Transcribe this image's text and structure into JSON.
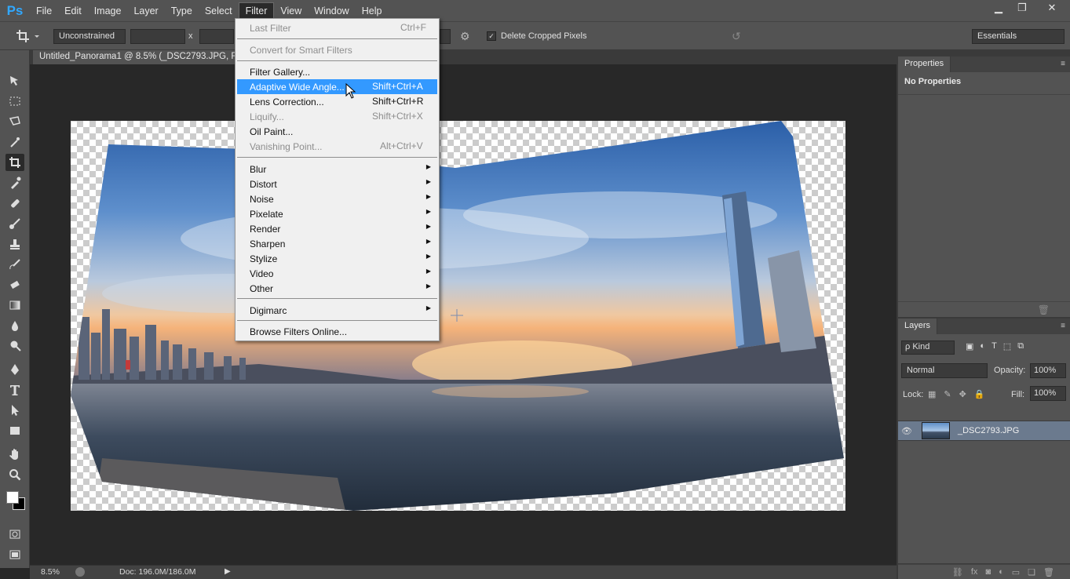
{
  "app": {
    "logo": "Ps"
  },
  "menubar": {
    "items": [
      "File",
      "Edit",
      "Image",
      "Layer",
      "Type",
      "Select",
      "Filter",
      "View",
      "Window",
      "Help"
    ],
    "active": "Filter"
  },
  "window_controls": {
    "minimize": "▁",
    "restore": "❐",
    "close": "✕"
  },
  "options": {
    "ratio_select": "Unconstrained",
    "separator_x": "x",
    "delete_cropped_label": "Delete Cropped Pixels",
    "delete_cropped_checked": "✓",
    "workspace": "Essentials"
  },
  "document": {
    "tab_title": "Untitled_Panorama1 @ 8.5% (_DSC2793.JPG, RGB/8)"
  },
  "status": {
    "zoom": "8.5%",
    "doc_info": "Doc: 196.0M/186.0M",
    "arrow": "▶"
  },
  "properties_panel": {
    "tab": "Properties",
    "message": "No Properties",
    "menu_icon": "≡"
  },
  "layers_panel": {
    "tab": "Layers",
    "menu_icon": "≡",
    "kind_select": "ρ Kind",
    "blend_mode": "Normal",
    "opacity_label": "Opacity:",
    "opacity_value": "100%",
    "lock_label": "Lock:",
    "fill_label": "Fill:",
    "fill_value": "100%",
    "layers": [
      {
        "name": "_DSC2793.JPG",
        "visible_icon": "👁"
      }
    ]
  },
  "filter_menu": {
    "items": [
      {
        "label": "Last Filter",
        "shortcut": "Ctrl+F",
        "disabled": true
      },
      {
        "label": "Convert for Smart Filters",
        "shortcut": "",
        "disabled": true
      },
      {
        "label": "Filter Gallery...",
        "shortcut": "",
        "disabled": false
      },
      {
        "label": "Adaptive Wide Angle...",
        "shortcut": "Shift+Ctrl+A",
        "disabled": false,
        "highlighted": true
      },
      {
        "label": "Lens Correction...",
        "shortcut": "Shift+Ctrl+R",
        "disabled": false
      },
      {
        "label": "Liquify...",
        "shortcut": "Shift+Ctrl+X",
        "disabled": true
      },
      {
        "label": "Oil Paint...",
        "shortcut": "",
        "disabled": false
      },
      {
        "label": "Vanishing Point...",
        "shortcut": "Alt+Ctrl+V",
        "disabled": true
      },
      {
        "label": "Blur",
        "submenu": true
      },
      {
        "label": "Distort",
        "submenu": true
      },
      {
        "label": "Noise",
        "submenu": true
      },
      {
        "label": "Pixelate",
        "submenu": true
      },
      {
        "label": "Render",
        "submenu": true
      },
      {
        "label": "Sharpen",
        "submenu": true
      },
      {
        "label": "Stylize",
        "submenu": true
      },
      {
        "label": "Video",
        "submenu": true
      },
      {
        "label": "Other",
        "submenu": true
      },
      {
        "label": "Digimarc",
        "submenu": true
      },
      {
        "label": "Browse Filters Online...",
        "shortcut": ""
      }
    ]
  },
  "colors": {
    "menu_highlight": "#3399ff",
    "panel_bg": "#535353",
    "workspace_bg": "#282828",
    "logo_blue": "#31a8ff"
  }
}
